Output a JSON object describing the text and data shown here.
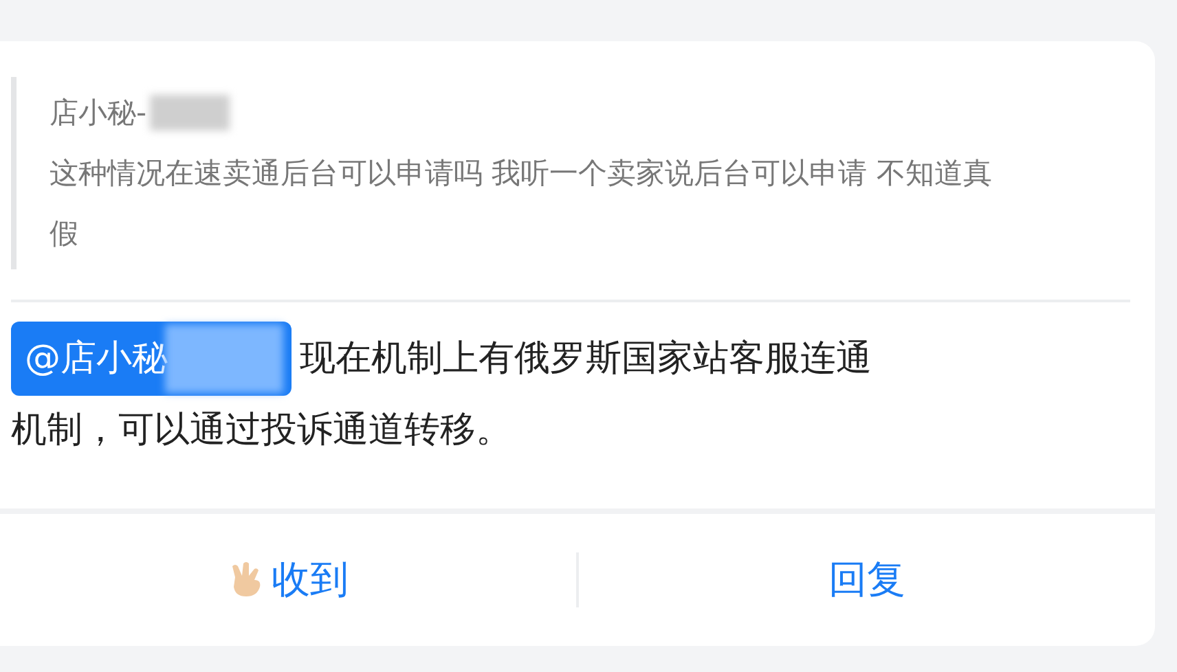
{
  "quote": {
    "author": "店小秘-",
    "text": "这种情况在速卖通后台可以申请吗 我听一个卖家说后台可以申请 不知道真假"
  },
  "message": {
    "mention": "@店小秘",
    "lines": [
      "现在机制上有俄罗斯国家站客服连通",
      "机制，可以通过投诉通道转移。"
    ]
  },
  "actions": [
    {
      "kind": "acknowledge",
      "label": "收到"
    },
    {
      "kind": "reply",
      "label": "回复"
    }
  ]
}
